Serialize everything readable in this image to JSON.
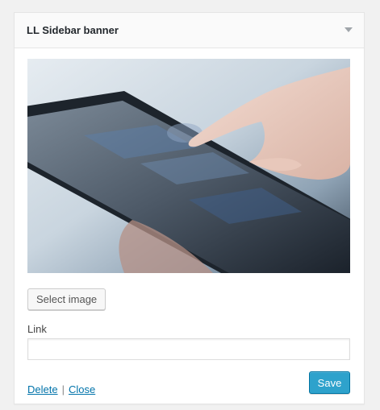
{
  "widget": {
    "title": "LL Sidebar banner",
    "select_image_label": "Select image",
    "link_label": "Link",
    "link_value": "",
    "delete_label": "Delete",
    "separator": "|",
    "close_label": "Close",
    "save_label": "Save"
  },
  "colors": {
    "accent": "#2ea2cc",
    "link": "#0073aa"
  }
}
